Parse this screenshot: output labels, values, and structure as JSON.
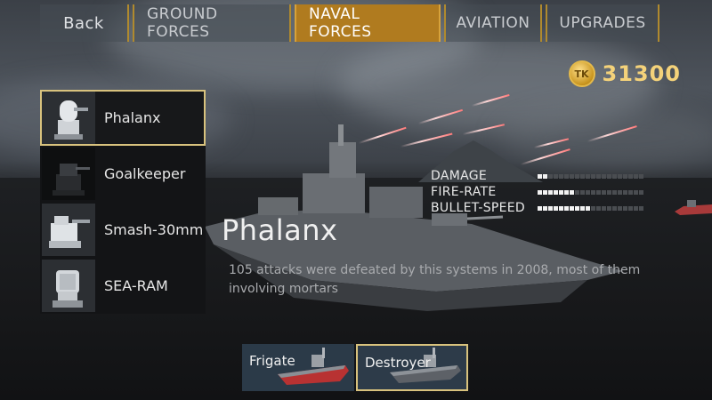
{
  "nav": {
    "back": "Back",
    "tabs": [
      "GROUND FORCES",
      "NAVAL FORCES",
      "AVIATION",
      "UPGRADES"
    ],
    "active_tab": "NAVAL FORCES"
  },
  "currency": {
    "icon": "coin-icon",
    "icon_text": "TK",
    "amount": "31300"
  },
  "weapons": [
    {
      "name": "Phalanx",
      "selected": true,
      "icon": "phalanx-turret-icon"
    },
    {
      "name": "Goalkeeper",
      "selected": false,
      "icon": "goalkeeper-turret-icon"
    },
    {
      "name": "Smash-30mm",
      "selected": false,
      "icon": "smash-turret-icon"
    },
    {
      "name": "SEA-RAM",
      "selected": false,
      "icon": "sea-ram-launcher-icon"
    }
  ],
  "stats": [
    {
      "label": "DAMAGE",
      "level": 2,
      "max": 20
    },
    {
      "label": "FIRE-RATE",
      "level": 7,
      "max": 20
    },
    {
      "label": "BULLET-SPEED",
      "level": 10,
      "max": 20
    }
  ],
  "selected_weapon": {
    "title": "Phalanx",
    "description": "105 attacks were defeated by this systems in 2008, most of them involving mortars"
  },
  "ships": [
    {
      "name": "Frigate",
      "selected": false
    },
    {
      "name": "Destroyer",
      "selected": true
    }
  ],
  "colors": {
    "accent_gold": "#b07b1f",
    "selection_border": "#d8c27d",
    "coin_text": "#f4d27a"
  }
}
